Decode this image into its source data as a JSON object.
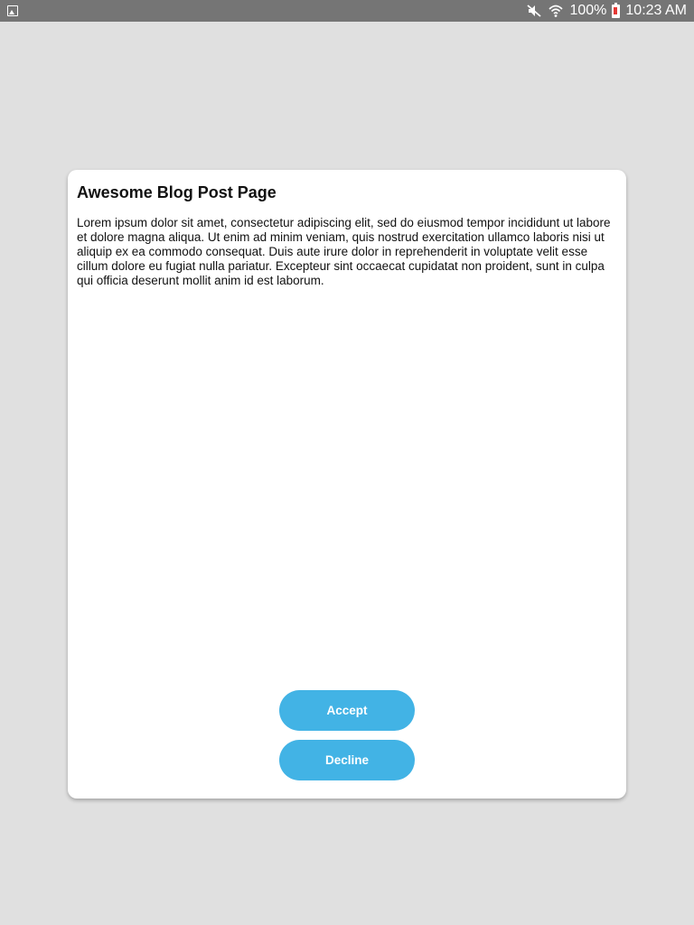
{
  "status_bar": {
    "left_icon": "gallery-icon",
    "battery_percent": "100%",
    "time": "10:23 AM",
    "icons": [
      "mute-icon",
      "wifi-icon",
      "battery-charging-icon"
    ]
  },
  "dialog": {
    "title": "Awesome Blog Post Page",
    "body": "Lorem ipsum dolor sit amet, consectetur adipiscing elit, sed do eiusmod tempor incididunt ut labore et dolore magna aliqua. Ut enim ad minim veniam, quis nostrud exercitation ullamco laboris nisi ut aliquip ex ea commodo consequat. Duis aute irure dolor in reprehenderit in voluptate velit esse cillum dolore eu fugiat nulla pariatur. Excepteur sint occaecat cupidatat non proident, sunt in culpa qui officia deserunt mollit anim id est laborum.",
    "accept_label": "Accept",
    "decline_label": "Decline"
  },
  "colors": {
    "background": "#e0e0e0",
    "status_bar": "#757575",
    "button": "#42b3e5",
    "card": "#ffffff"
  }
}
